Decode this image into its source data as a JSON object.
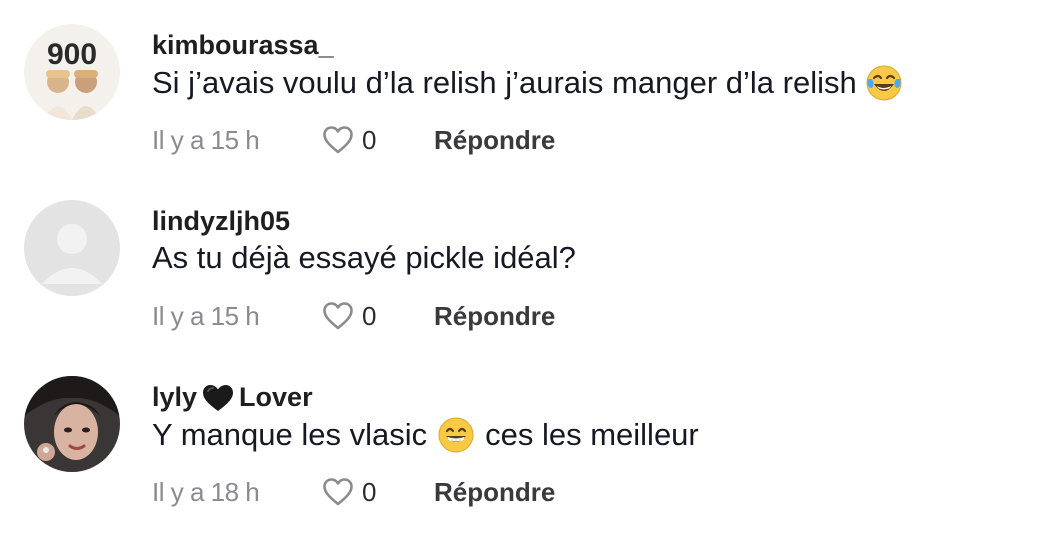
{
  "comments": [
    {
      "username": "kimbourassa_",
      "username_suffix": "",
      "text_before": "Si j’avais voulu d’la relish j’aurais manger d’la relish",
      "emoji": "tears-of-joy-emoji",
      "text_after": "",
      "timestamp": "Il y a 15 h",
      "likes": "0",
      "reply_label": "Répondre",
      "avatar_text": "900"
    },
    {
      "username": "lindyzljh05",
      "username_suffix": "",
      "text_before": "As tu déjà essayé pickle idéal?",
      "emoji": "",
      "text_after": "",
      "timestamp": "Il y a 15 h",
      "likes": "0",
      "reply_label": "Répondre"
    },
    {
      "username": "lyly",
      "username_suffix": "Lover",
      "username_emoji": "black-heart-emoji",
      "text_before": "Y manque les vlasic",
      "emoji": "grinning-emoji",
      "text_after": "ces les meilleur",
      "timestamp": "Il y a 18 h",
      "likes": "0",
      "reply_label": "Répondre"
    }
  ],
  "colors": {
    "text": "#161823",
    "muted": "#8a8b91",
    "background": "#ffffff",
    "placeholder_avatar": "#e3e3e3"
  }
}
